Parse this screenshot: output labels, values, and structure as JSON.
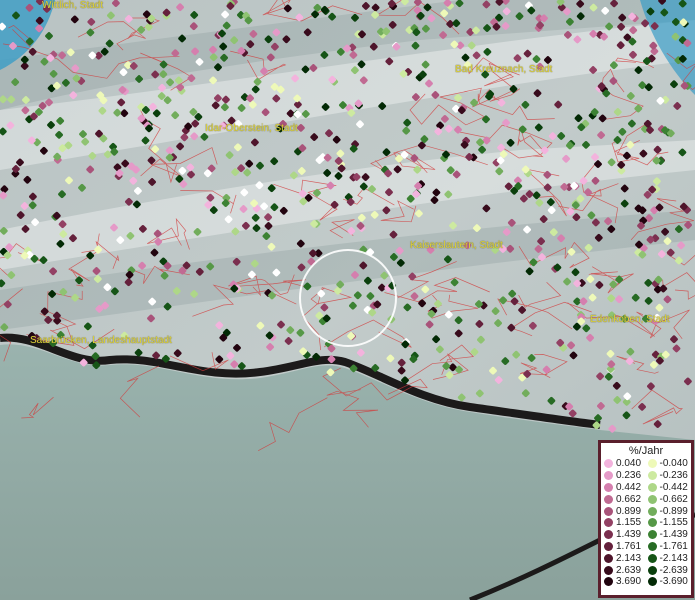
{
  "cities": [
    {
      "name": "Wittlich, Stadt"
    },
    {
      "name": "Bad Kreuznach, Stadt"
    },
    {
      "name": "Idar-Oberstein, Stadt"
    },
    {
      "name": "Kaiserslautern, Stadt"
    },
    {
      "name": "Saarbrücken, Landeshauptstadt"
    },
    {
      "name": "Edenkoben, Stadt"
    }
  ],
  "legend": {
    "title": "%/Jahr",
    "positive": [
      {
        "label": "0.040",
        "color": "#f3b3dd"
      },
      {
        "label": "0.236",
        "color": "#e59ac8"
      },
      {
        "label": "0.442",
        "color": "#d57fae"
      },
      {
        "label": "0.662",
        "color": "#c06a92"
      },
      {
        "label": "0.899",
        "color": "#a9537a"
      },
      {
        "label": "1.155",
        "color": "#934164"
      },
      {
        "label": "1.439",
        "color": "#7b2f4f"
      },
      {
        "label": "1.761",
        "color": "#65213c"
      },
      {
        "label": "2.143",
        "color": "#4e152b"
      },
      {
        "label": "2.639",
        "color": "#380b1c"
      },
      {
        "label": "3.690",
        "color": "#22040f"
      }
    ],
    "negative": [
      {
        "label": "-0.040",
        "color": "#eef9b8"
      },
      {
        "label": "-0.236",
        "color": "#cdeaa0"
      },
      {
        "label": "-0.442",
        "color": "#aed788"
      },
      {
        "label": "-0.662",
        "color": "#8fc372"
      },
      {
        "label": "-0.899",
        "color": "#72ad5c"
      },
      {
        "label": "-1.155",
        "color": "#569847"
      },
      {
        "label": "-1.439",
        "color": "#3c8233"
      },
      {
        "label": "-1.761",
        "color": "#276b24"
      },
      {
        "label": "-2.143",
        "color": "#165517"
      },
      {
        "label": "-2.639",
        "color": "#0b400d"
      },
      {
        "label": "-3.690",
        "color": "#032a05"
      }
    ]
  }
}
